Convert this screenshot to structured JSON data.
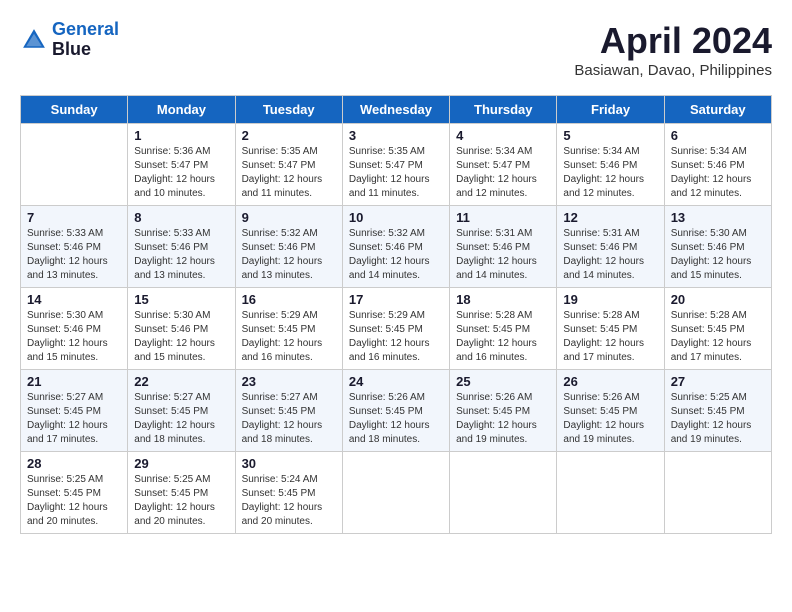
{
  "header": {
    "logo_line1": "General",
    "logo_line2": "Blue",
    "month_title": "April 2024",
    "subtitle": "Basiawan, Davao, Philippines"
  },
  "weekdays": [
    "Sunday",
    "Monday",
    "Tuesday",
    "Wednesday",
    "Thursday",
    "Friday",
    "Saturday"
  ],
  "weeks": [
    [
      {
        "day": "",
        "sunrise": "",
        "sunset": "",
        "daylight": ""
      },
      {
        "day": "1",
        "sunrise": "5:36 AM",
        "sunset": "5:47 PM",
        "daylight": "12 hours and 10 minutes."
      },
      {
        "day": "2",
        "sunrise": "5:35 AM",
        "sunset": "5:47 PM",
        "daylight": "12 hours and 11 minutes."
      },
      {
        "day": "3",
        "sunrise": "5:35 AM",
        "sunset": "5:47 PM",
        "daylight": "12 hours and 11 minutes."
      },
      {
        "day": "4",
        "sunrise": "5:34 AM",
        "sunset": "5:47 PM",
        "daylight": "12 hours and 12 minutes."
      },
      {
        "day": "5",
        "sunrise": "5:34 AM",
        "sunset": "5:46 PM",
        "daylight": "12 hours and 12 minutes."
      },
      {
        "day": "6",
        "sunrise": "5:34 AM",
        "sunset": "5:46 PM",
        "daylight": "12 hours and 12 minutes."
      }
    ],
    [
      {
        "day": "7",
        "sunrise": "5:33 AM",
        "sunset": "5:46 PM",
        "daylight": "12 hours and 13 minutes."
      },
      {
        "day": "8",
        "sunrise": "5:33 AM",
        "sunset": "5:46 PM",
        "daylight": "12 hours and 13 minutes."
      },
      {
        "day": "9",
        "sunrise": "5:32 AM",
        "sunset": "5:46 PM",
        "daylight": "12 hours and 13 minutes."
      },
      {
        "day": "10",
        "sunrise": "5:32 AM",
        "sunset": "5:46 PM",
        "daylight": "12 hours and 14 minutes."
      },
      {
        "day": "11",
        "sunrise": "5:31 AM",
        "sunset": "5:46 PM",
        "daylight": "12 hours and 14 minutes."
      },
      {
        "day": "12",
        "sunrise": "5:31 AM",
        "sunset": "5:46 PM",
        "daylight": "12 hours and 14 minutes."
      },
      {
        "day": "13",
        "sunrise": "5:30 AM",
        "sunset": "5:46 PM",
        "daylight": "12 hours and 15 minutes."
      }
    ],
    [
      {
        "day": "14",
        "sunrise": "5:30 AM",
        "sunset": "5:46 PM",
        "daylight": "12 hours and 15 minutes."
      },
      {
        "day": "15",
        "sunrise": "5:30 AM",
        "sunset": "5:46 PM",
        "daylight": "12 hours and 15 minutes."
      },
      {
        "day": "16",
        "sunrise": "5:29 AM",
        "sunset": "5:45 PM",
        "daylight": "12 hours and 16 minutes."
      },
      {
        "day": "17",
        "sunrise": "5:29 AM",
        "sunset": "5:45 PM",
        "daylight": "12 hours and 16 minutes."
      },
      {
        "day": "18",
        "sunrise": "5:28 AM",
        "sunset": "5:45 PM",
        "daylight": "12 hours and 16 minutes."
      },
      {
        "day": "19",
        "sunrise": "5:28 AM",
        "sunset": "5:45 PM",
        "daylight": "12 hours and 17 minutes."
      },
      {
        "day": "20",
        "sunrise": "5:28 AM",
        "sunset": "5:45 PM",
        "daylight": "12 hours and 17 minutes."
      }
    ],
    [
      {
        "day": "21",
        "sunrise": "5:27 AM",
        "sunset": "5:45 PM",
        "daylight": "12 hours and 17 minutes."
      },
      {
        "day": "22",
        "sunrise": "5:27 AM",
        "sunset": "5:45 PM",
        "daylight": "12 hours and 18 minutes."
      },
      {
        "day": "23",
        "sunrise": "5:27 AM",
        "sunset": "5:45 PM",
        "daylight": "12 hours and 18 minutes."
      },
      {
        "day": "24",
        "sunrise": "5:26 AM",
        "sunset": "5:45 PM",
        "daylight": "12 hours and 18 minutes."
      },
      {
        "day": "25",
        "sunrise": "5:26 AM",
        "sunset": "5:45 PM",
        "daylight": "12 hours and 19 minutes."
      },
      {
        "day": "26",
        "sunrise": "5:26 AM",
        "sunset": "5:45 PM",
        "daylight": "12 hours and 19 minutes."
      },
      {
        "day": "27",
        "sunrise": "5:25 AM",
        "sunset": "5:45 PM",
        "daylight": "12 hours and 19 minutes."
      }
    ],
    [
      {
        "day": "28",
        "sunrise": "5:25 AM",
        "sunset": "5:45 PM",
        "daylight": "12 hours and 20 minutes."
      },
      {
        "day": "29",
        "sunrise": "5:25 AM",
        "sunset": "5:45 PM",
        "daylight": "12 hours and 20 minutes."
      },
      {
        "day": "30",
        "sunrise": "5:24 AM",
        "sunset": "5:45 PM",
        "daylight": "12 hours and 20 minutes."
      },
      {
        "day": "",
        "sunrise": "",
        "sunset": "",
        "daylight": ""
      },
      {
        "day": "",
        "sunrise": "",
        "sunset": "",
        "daylight": ""
      },
      {
        "day": "",
        "sunrise": "",
        "sunset": "",
        "daylight": ""
      },
      {
        "day": "",
        "sunrise": "",
        "sunset": "",
        "daylight": ""
      }
    ]
  ]
}
